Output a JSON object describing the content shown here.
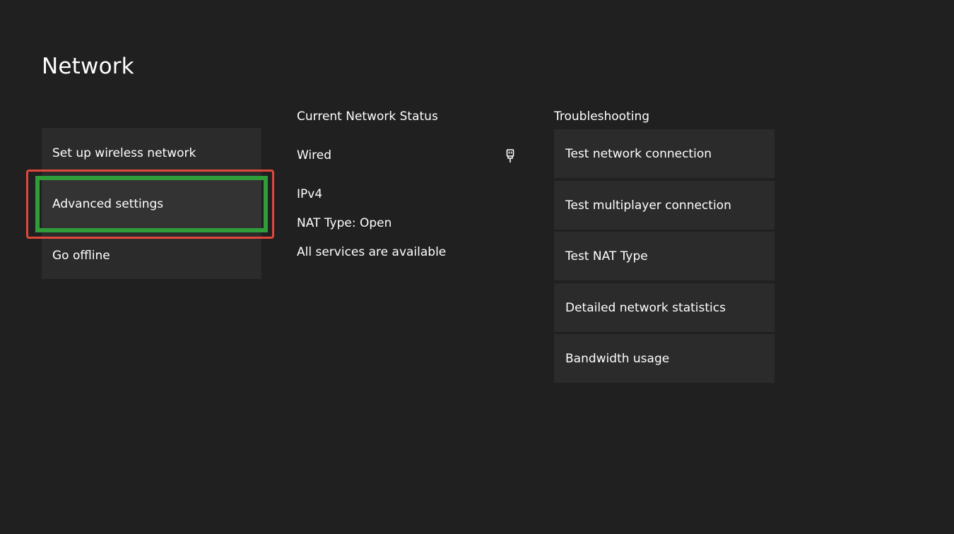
{
  "page": {
    "title": "Network"
  },
  "left_menu": {
    "items": [
      {
        "label": "Set up wireless network"
      },
      {
        "label": "Advanced settings",
        "focused": true
      },
      {
        "label": "Go offline"
      }
    ]
  },
  "status": {
    "heading": "Current Network Status",
    "connection": "Wired",
    "connection_icon": "ethernet-plug-icon",
    "ip_version": "IPv4",
    "nat_type": "NAT Type: Open",
    "services": "All services are available"
  },
  "troubleshooting": {
    "heading": "Troubleshooting",
    "items": [
      {
        "label": "Test network connection"
      },
      {
        "label": "Test multiplayer connection"
      },
      {
        "label": "Test NAT Type"
      },
      {
        "label": "Detailed network statistics"
      },
      {
        "label": "Bandwidth usage"
      }
    ]
  },
  "colors": {
    "background": "#202020",
    "tile": "#2b2b2b",
    "focus_ring": "#2f9d3a",
    "annotation": "#e0473c"
  }
}
